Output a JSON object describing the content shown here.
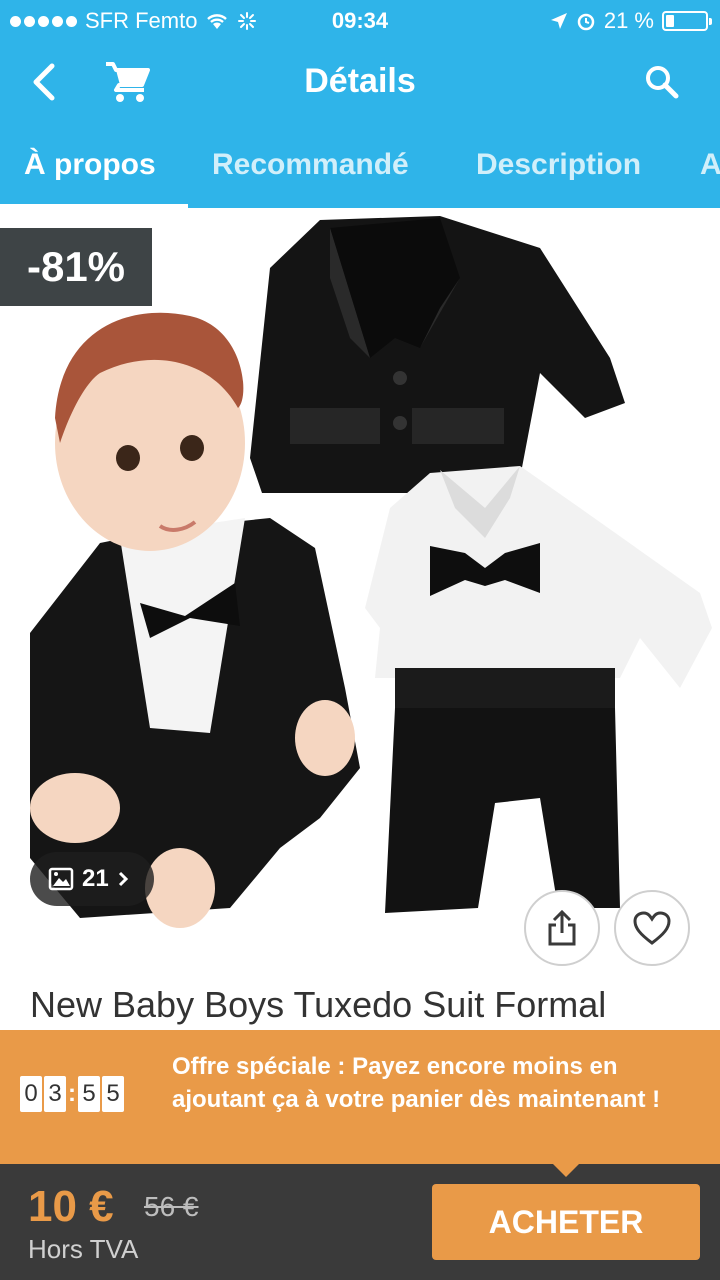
{
  "status_bar": {
    "carrier": "SFR Femto",
    "time": "09:34",
    "battery": "21 %",
    "battery_level": 0.21
  },
  "header": {
    "title": "Détails",
    "icons": [
      "back-arrow-icon",
      "cart-icon",
      "search-icon"
    ]
  },
  "tabs": [
    {
      "label": "À propos",
      "active": true
    },
    {
      "label": "Recommandé",
      "active": false
    },
    {
      "label": "Description",
      "active": false
    },
    {
      "label": "A",
      "active": false
    }
  ],
  "product": {
    "discount": "-81%",
    "gallery_count": "21",
    "title": "New Baby Boys Tuxedo Suit Formal"
  },
  "offer": {
    "timer_digits": [
      "0",
      "3",
      "5",
      "5"
    ],
    "text": "Offre spéciale : Payez encore moins en ajoutant ça à votre panier dès maintenant !"
  },
  "purchase": {
    "price": "10 €",
    "old_price": "56 €",
    "tax_note": "Hors TVA",
    "buy_label": "ACHETER"
  },
  "colors": {
    "header": "#2fb4e9",
    "accent": "#e99a48",
    "bottom_bar": "#3a3a3a",
    "badge": "#3e4446"
  }
}
